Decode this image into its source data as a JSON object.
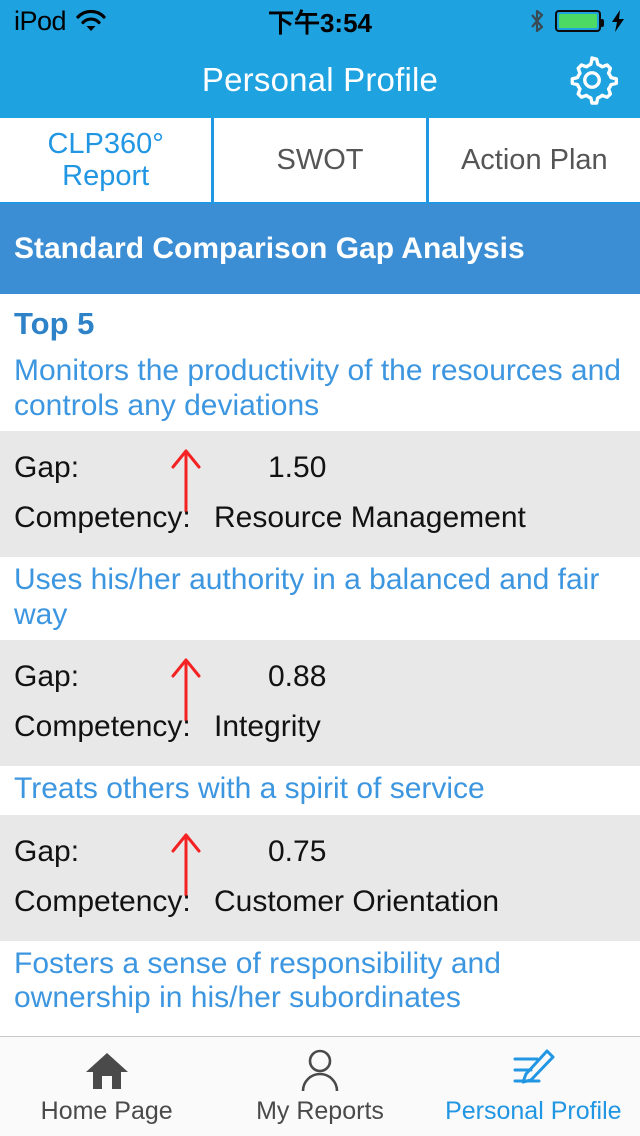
{
  "status_bar": {
    "carrier": "iPod",
    "time": "下午3:54",
    "wifi_icon": "wifi-icon",
    "bluetooth_icon": "bluetooth-icon",
    "battery_icon": "battery-charging-icon",
    "battery_color": "#4cd964"
  },
  "nav": {
    "title": "Personal Profile",
    "settings_icon": "gear-icon",
    "background": "#1fa2e0"
  },
  "tabs": [
    {
      "label": "CLP360° Report",
      "active": true
    },
    {
      "label": "SWOT",
      "active": false
    },
    {
      "label": "Action Plan",
      "active": false
    }
  ],
  "banner": {
    "title": "Standard Comparison Gap Analysis",
    "background": "#3b8ed4"
  },
  "section": {
    "title": "Top 5",
    "gap_label": "Gap:",
    "competency_label": "Competency:",
    "arrow_icon": "arrow-up-icon",
    "arrow_color": "#f42222"
  },
  "items": [
    {
      "title": "Monitors the productivity of the resources and controls any deviations",
      "gap": "1.50",
      "competency": "Resource Management"
    },
    {
      "title": "Uses his/her authority in a balanced and fair way",
      "gap": "0.88",
      "competency": "Integrity"
    },
    {
      "title": "Treats others with a spirit of service",
      "gap": "0.75",
      "competency": "Customer Orientation"
    },
    {
      "title": "Fosters a sense of responsibility and ownership in his/her subordinates",
      "gap": "",
      "competency": ""
    }
  ],
  "tabbar": [
    {
      "label": "Home Page",
      "icon": "home-icon",
      "active": false
    },
    {
      "label": "My Reports",
      "icon": "person-icon",
      "active": false
    },
    {
      "label": "Personal Profile",
      "icon": "edit-pencil-icon",
      "active": true
    }
  ]
}
